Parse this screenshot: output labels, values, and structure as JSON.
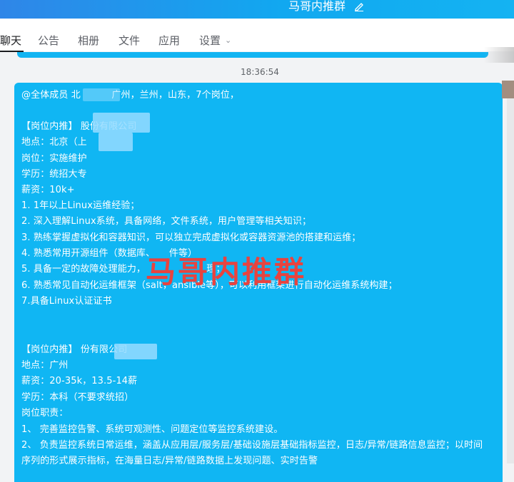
{
  "header": {
    "title": "马哥内推群"
  },
  "tabs": [
    {
      "label": "聊天"
    },
    {
      "label": "公告"
    },
    {
      "label": "相册"
    },
    {
      "label": "文件"
    },
    {
      "label": "应用"
    },
    {
      "label": "设置"
    }
  ],
  "chat": {
    "timestamp": "18:36:54",
    "message_lines": [
      "@全体成员 北　　　  广州，兰州，山东，7个岗位，",
      "",
      "【岗位内推】                            股份有限公司",
      "地点：北京（上",
      "岗位：实施维护",
      "学历：统招大专",
      "薪资：10k+",
      "1. 1年以上Linux运维经验；",
      "2. 深入理解Linux系统，具备网络，文件系统，用户管理等相关知识；",
      "3. 熟练掌握虚拟化和容器知识，可以独立完成虚拟化或容器资源池的搭建和运维；",
      "4. 熟悉常用开源组件（数据库、　　件等）",
      "5. 具备一定的故障处理能力，　　　　　　　理；",
      "6. 熟悉常见自动化运维框架（salt，ansible等），可以利用框架进行自动化运维系统构建；",
      "7.具备Linux认证证书",
      "",
      "",
      "【岗位内推】                             份有限公司",
      "地点：广州",
      "薪资：20-35k，13.5-14薪",
      "学历：本科（不要求统招）",
      "岗位职责：",
      "1、 完善监控告警、系统可观测性、问题定位等监控系统建设。",
      "2、 负责监控系统日常运维，涵盖从应用层/服务层/基础设施层基础指标监控，日志/异常/链路信息监控；以时间",
      "序列的形式展示指标，在海量日志/异常/链路数据上发现问题、实时告警"
    ]
  },
  "watermark": {
    "text": "马哥内推群",
    "color": "#e8433f"
  },
  "colors": {
    "accent": "#10b6f3",
    "title_bar": "#2f86e8"
  },
  "icons": {
    "edit": "edit-pencil-icon",
    "dropdown": "chevron-down-icon"
  }
}
